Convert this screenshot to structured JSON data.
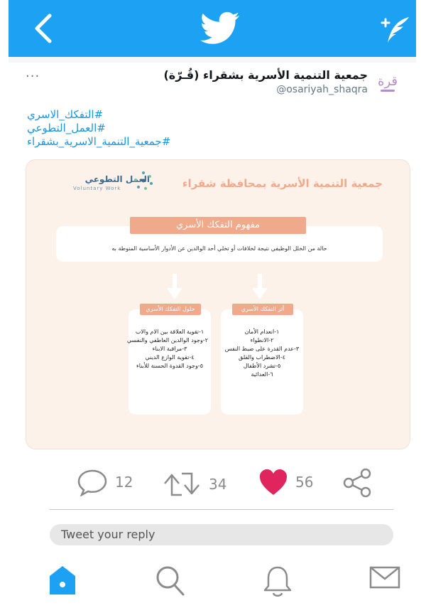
{
  "tweet": {
    "display_name": "جمعية التنمية الأسرية بشقراء (قُـرّة)",
    "handle": "@osariyah_shaqra",
    "more": "...",
    "hashtags": [
      "#التفكك_الاسري",
      "#العمل_التطوعي",
      "#جمعية_التنمية_الاسرية_بشقراء"
    ]
  },
  "media": {
    "logo_text": "العمل التطوعي",
    "logo_sub": "Voluntary Work",
    "org_title": "جمعية التنمية الأسرية بمحافظة شقراء",
    "concept_title": "مفهوم التفكك الأسري",
    "concept_text": "حالة من الخلل الوظيفي نتيجة لخلافات أو تخلي أحد الوالدين عن الأدوار الأساسية المنوطة به",
    "effects_title": "أثر التفكك الأسري",
    "effects": [
      "١-انعدام الأمان",
      "٢-الانطواء",
      "٣-عدم القدرة على ضبط النفس",
      "٤-الاضطراب والقلق",
      "٥-تشرد الأطفال",
      "٦-العدائية"
    ],
    "solutions_title": "حلول التفكك الأسري",
    "solutions": [
      "١-تقوية العلاقة بين الام والاب",
      "٢-وجود الوالدين العاطفي والنفسي",
      "٣-مراقبة الابناء",
      "٤-تقوية الوازع الديني",
      "٥-وجود القدوة الحسنة للأبناء"
    ]
  },
  "actions": {
    "replies": "12",
    "retweets": "34",
    "likes": "56"
  },
  "reply": {
    "placeholder": "Tweet your reply"
  },
  "colors": {
    "brand": "#1da1f2",
    "like": "#e0245e",
    "hashtag": "#1b95e0",
    "accent_peach": "#f0a98b"
  },
  "icons": {
    "back": "chevron-left-icon",
    "logo": "twitter-bird-icon",
    "compose": "compose-feather-icon",
    "reply": "reply-bubble-icon",
    "retweet": "retweet-icon",
    "like": "heart-icon",
    "share": "share-icon",
    "home": "home-icon",
    "search": "search-icon",
    "notifications": "bell-icon",
    "messages": "mail-icon"
  }
}
